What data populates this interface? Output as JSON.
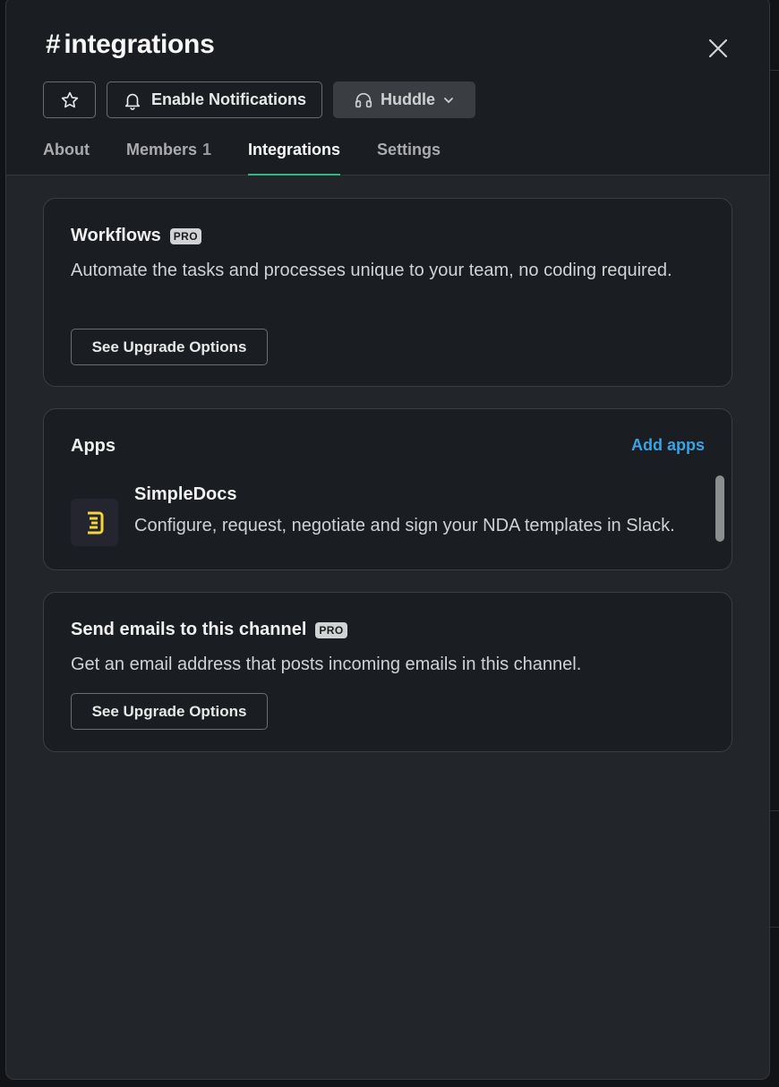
{
  "channel": {
    "hash": "#",
    "name": "integrations"
  },
  "header": {
    "enable_notifications_label": "Enable Notifications",
    "huddle_label": "Huddle"
  },
  "tabs": [
    {
      "label": "About",
      "count": ""
    },
    {
      "label": "Members",
      "count": "1"
    },
    {
      "label": "Integrations",
      "count": "",
      "active": true
    },
    {
      "label": "Settings",
      "count": ""
    }
  ],
  "workflows": {
    "title": "Workflows",
    "badge": "PRO",
    "description": "Automate the tasks and processes unique to your team, no coding required.",
    "button_label": "See Upgrade Options"
  },
  "apps": {
    "title": "Apps",
    "add_label": "Add apps",
    "items": [
      {
        "name": "SimpleDocs",
        "description": "Configure, request, negotiate and sign your NDA templates in Slack.",
        "icon": "simpledocs-icon",
        "icon_color": "#f2d43d"
      }
    ]
  },
  "emails": {
    "title": "Send emails to this channel",
    "badge": "PRO",
    "description": "Get an email address that posts incoming emails in this channel.",
    "button_label": "See Upgrade Options"
  },
  "colors": {
    "accent_tab": "#2eb67d",
    "link": "#3aa3e3",
    "background": "#222529",
    "card": "#1a1d21"
  }
}
